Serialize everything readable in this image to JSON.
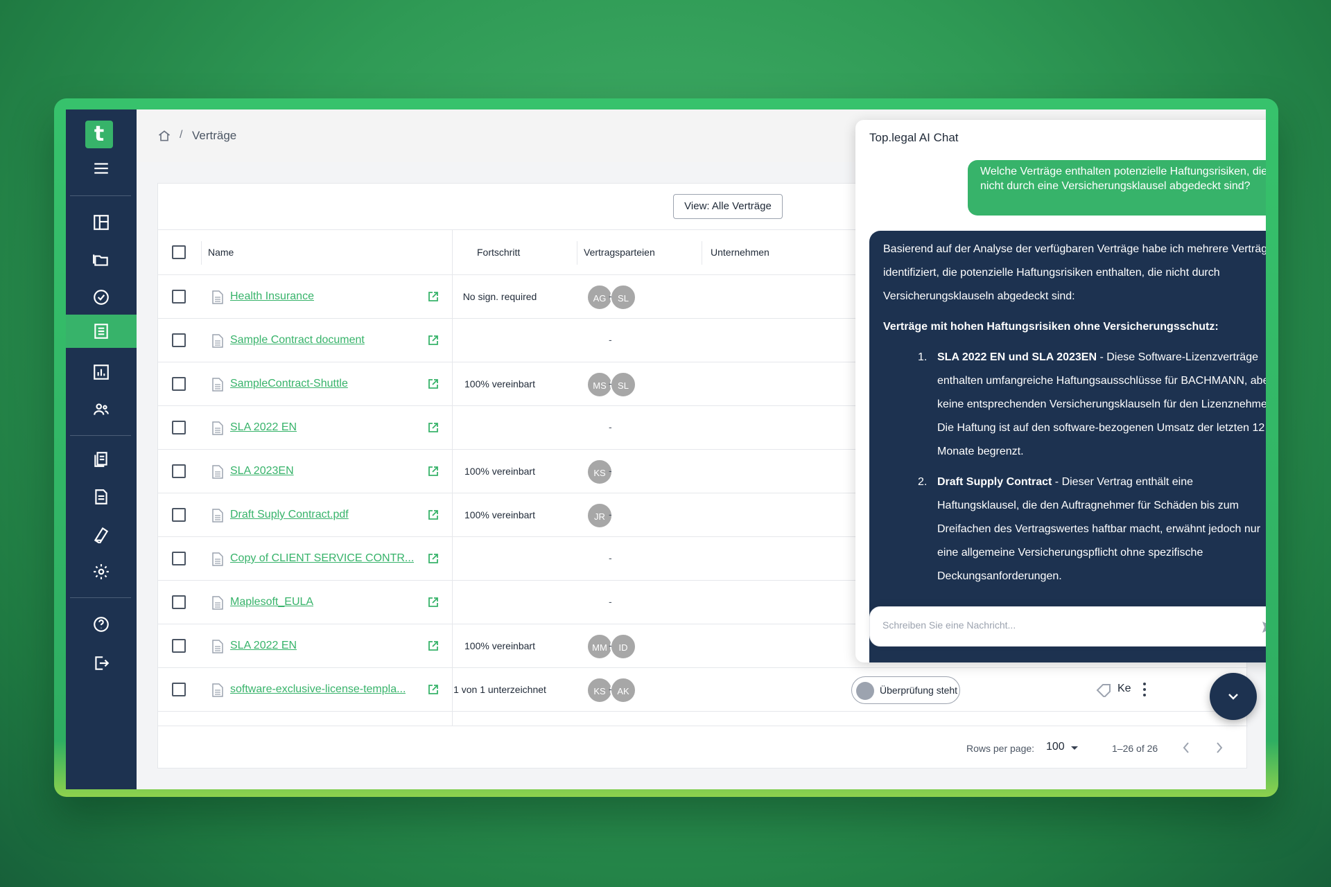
{
  "breadcrumb": {
    "separator": "/",
    "current": "Verträge"
  },
  "toolbar": {
    "view_label": "View: Alle Verträge"
  },
  "table": {
    "columns": [
      "Name",
      "Fortschritt",
      "Vertragsparteien",
      "Unternehmen"
    ],
    "rows": [
      {
        "name": "Health Insurance",
        "progress": "No sign. required",
        "parties": [
          "AG",
          "SL"
        ],
        "company": "-"
      },
      {
        "name": "Sample Contract document",
        "progress": "-",
        "parties": [],
        "company": "-"
      },
      {
        "name": "SampleContract-Shuttle",
        "progress": "100% vereinbart",
        "parties": [
          "MS",
          "SL"
        ],
        "company": "-"
      },
      {
        "name": "SLA 2022 EN",
        "progress": "-",
        "parties": [],
        "company": "-"
      },
      {
        "name": "SLA 2023EN",
        "progress": "100% vereinbart",
        "parties": [
          "KS"
        ],
        "company": "-"
      },
      {
        "name": "Draft Suply Contract.pdf",
        "progress": "100% vereinbart",
        "parties": [
          "JR"
        ],
        "company": "-"
      },
      {
        "name": "Copy of CLIENT SERVICE CONTR...",
        "progress": "-",
        "parties": [],
        "company": "-"
      },
      {
        "name": "Maplesoft_EULA",
        "progress": "-",
        "parties": [],
        "company": "-"
      },
      {
        "name": "SLA 2022 EN",
        "progress": "100% vereinbart",
        "parties": [
          "MM",
          "ID"
        ],
        "company": "-"
      },
      {
        "name": "software-exclusive-license-templa...",
        "progress": "1 von 1 unterzeichnet",
        "parties": [
          "KS",
          "AK"
        ],
        "company": "-",
        "status": "Überprüfung steht",
        "extra": "Ke"
      }
    ]
  },
  "pagination": {
    "rows_per_page_label": "Rows per page:",
    "rows_per_page": "100",
    "range": "1–26 of 26"
  },
  "chat": {
    "title": "Top.legal AI Chat",
    "user_message": "Welche Verträge enthalten potenzielle Haftungsrisiken, die nicht durch eine Versicherungsklausel abgedeckt sind?",
    "ai_intro": "Basierend auf der Analyse der verfügbaren Verträge habe ich mehrere Verträge identifiziert, die potenzielle Haftungsrisiken enthalten, die nicht durch Versicherungsklauseln abgedeckt sind:",
    "ai_heading": "Verträge mit hohen Haftungsrisiken ohne Versicherungsschutz:",
    "ai_items": [
      {
        "num": "1.",
        "title": "SLA 2022 EN und SLA 2023EN",
        "text": " - Diese Software-Lizenzverträge enthalten umfangreiche Haftungsausschlüsse für BACHMANN, aber keine entsprechenden Versicherungsklauseln für den Lizenznehmer. Die Haftung ist auf den software-bezogenen Umsatz der letzten 12 Monate begrenzt."
      },
      {
        "num": "2.",
        "title": "Draft Supply Contract",
        "text": " - Dieser Vertrag enthält eine Haftungsklausel, die den Auftragnehmer für Schäden bis zum Dreifachen des Vertragswertes haftbar macht, erwähnt jedoch nur eine allgemeine Versicherungspflicht ohne spezifische Deckungsanforderungen."
      }
    ],
    "input_placeholder": "Schreiben Sie eine Nachricht..."
  },
  "colors": {
    "brand": "#37b36a",
    "sidebar": "#1d3250",
    "avatar": "#a7a7a7"
  }
}
